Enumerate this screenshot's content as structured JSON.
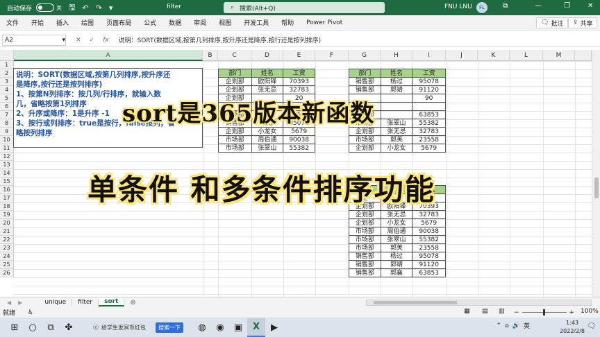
{
  "titlebar": {
    "autosave_label": "自动保存",
    "toggle_state": "关",
    "filename": "filter",
    "search_placeholder": "搜索(Alt+Q)",
    "user_name": "FNU LNU",
    "user_initials": "FL"
  },
  "ribbon": {
    "tabs": [
      "文件",
      "开始",
      "插入",
      "绘图",
      "页面布局",
      "公式",
      "数据",
      "审阅",
      "视图",
      "开发工具",
      "帮助",
      "Power Pivot"
    ],
    "comment_label": "批注",
    "share_label": "共享"
  },
  "formula_bar": {
    "name_box": "A2",
    "cancel_glyph": "✕",
    "enter_glyph": "✓",
    "fx_glyph": "fx",
    "formula": "说明：SORT(数据区域,按第几列排序,按升序还是降序,按行还是按列排序)"
  },
  "columns": [
    "A",
    "B",
    "C",
    "D",
    "E",
    "F",
    "G",
    "H",
    "I",
    "J",
    "K",
    "L",
    "M"
  ],
  "rows": [
    "1",
    "2",
    "3",
    "4",
    "5",
    "6",
    "7",
    "8",
    "9",
    "10",
    "11",
    "12",
    "13",
    "14",
    "15",
    "16",
    "17",
    "18",
    "19",
    "20",
    "21",
    "22",
    "23",
    "24",
    "25",
    "26"
  ],
  "note": {
    "lines": [
      "说明：SORT(数据区域,按第几列排序,按升序还",
      "是降序,按行还是按列排序)",
      "1、按第N列排序：按几列/行排序，就输入数",
      "几，省略按第1列排序",
      "2、升序或降序：1是升序  -1",
      "3、按行或列排序：true是按行，false按列，省",
      "略按列排序"
    ]
  },
  "table1": {
    "headers": [
      "部门",
      "姓名",
      "工资"
    ],
    "rows": [
      [
        "企划部",
        "欧阳锋",
        "70393"
      ],
      [
        "企划部",
        "张无忌",
        "32783"
      ],
      [
        "企划部",
        "",
        "20"
      ],
      [
        "",
        "",
        ""
      ],
      [
        "市场部",
        "郭芙",
        "23558"
      ],
      [
        "销售部",
        "杨过",
        "95078"
      ],
      [
        "企划部",
        "小龙女",
        "5679"
      ],
      [
        "市场部",
        "周伯通",
        "90038"
      ],
      [
        "市场部",
        "张翠山",
        "55382"
      ]
    ]
  },
  "table2": {
    "headers": [
      "部门",
      "姓名",
      "工资"
    ],
    "rows": [
      [
        "销售部",
        "杨过",
        "95078"
      ],
      [
        "销售部",
        "郭靖",
        "91120"
      ],
      [
        "",
        "",
        "90"
      ],
      [
        "",
        "",
        ""
      ],
      [
        "销售部",
        "",
        "63853"
      ],
      [
        "市场部",
        "张翠山",
        "55382"
      ],
      [
        "企划部",
        "张无忌",
        "32783"
      ],
      [
        "市场部",
        "郭芙",
        "23558"
      ],
      [
        "企划部",
        "小龙女",
        "5679"
      ]
    ]
  },
  "table3": {
    "header": [
      "部门",
      "",
      "工资"
    ],
    "rows": [
      [
        "企",
        "",
        "823"
      ],
      [
        "企划部",
        "欧阳锋",
        "70393"
      ],
      [
        "企划部",
        "张无忌",
        "32783"
      ],
      [
        "企划部",
        "小龙女",
        "5679"
      ],
      [
        "市场部",
        "周伯通",
        "90038"
      ],
      [
        "市场部",
        "张翠山",
        "55382"
      ],
      [
        "市场部",
        "郭芙",
        "23558"
      ],
      [
        "销售部",
        "杨过",
        "95078"
      ],
      [
        "销售部",
        "郭靖",
        "91120"
      ],
      [
        "销售部",
        "郭襄",
        "63853"
      ]
    ]
  },
  "overlay": {
    "line1": "sort是365版本新函数",
    "line2": "单条件 和多条件排序功能"
  },
  "sheets": [
    "unique",
    "filter",
    "sort"
  ],
  "active_sheet": "sort",
  "status": {
    "ready": "就绪",
    "zoom": "100%"
  },
  "taskbar": {
    "search_text": "给学生发冥币红包",
    "search_button": "搜索一下",
    "ime": "英",
    "time": "1:43",
    "date": "2022/2/8"
  },
  "colors": {
    "excel_green": "#1e6b41",
    "header_fill": "#a9d18e",
    "note_text": "#2154a6",
    "overlay_glow": "#ffe57a"
  }
}
